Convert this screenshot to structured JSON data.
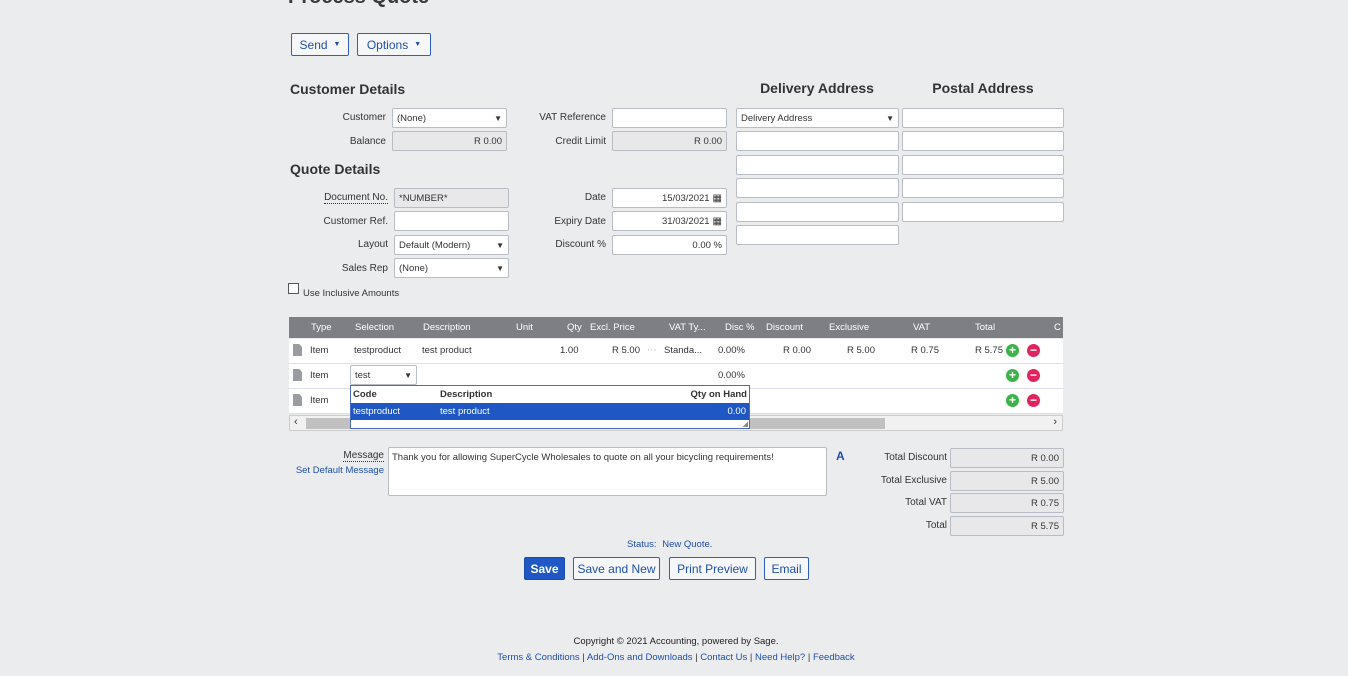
{
  "page": {
    "title": "Process Quote"
  },
  "toolbar": {
    "send_label": "Send",
    "options_label": "Options"
  },
  "customer_details": {
    "heading": "Customer Details",
    "customer_label": "Customer",
    "customer_value": "(None)",
    "balance_label": "Balance",
    "balance_value": "R 0.00",
    "vat_ref_label": "VAT Reference",
    "vat_ref_value": "",
    "credit_limit_label": "Credit Limit",
    "credit_limit_value": "R 0.00"
  },
  "quote_details": {
    "heading": "Quote Details",
    "doc_no_label": "Document No.",
    "doc_no_value": "*NUMBER*",
    "cust_ref_label": "Customer Ref.",
    "cust_ref_value": "",
    "layout_label": "Layout",
    "layout_value": "Default (Modern)",
    "sales_rep_label": "Sales Rep",
    "sales_rep_value": "(None)",
    "date_label": "Date",
    "date_value": "15/03/2021",
    "expiry_label": "Expiry Date",
    "expiry_value": "31/03/2021",
    "discount_label": "Discount %",
    "discount_value": "0.00 %",
    "inclusive_label": "Use Inclusive Amounts"
  },
  "delivery": {
    "heading": "Delivery Address",
    "select_value": "Delivery Address"
  },
  "postal": {
    "heading": "Postal Address"
  },
  "grid": {
    "headers": [
      "Type",
      "Selection",
      "Description",
      "Unit",
      "Qty",
      "Excl. Price",
      "VAT Ty...",
      "Disc %",
      "Discount",
      "Exclusive",
      "VAT",
      "Total",
      "C"
    ],
    "rows": [
      {
        "type": "Item",
        "selection": "testproduct",
        "description": "test product",
        "qty": "1.00",
        "price": "R 5.00",
        "vat_type": "Standa...",
        "disc": "0.00%",
        "discount": "R 0.00",
        "exclusive": "R 5.00",
        "vat": "R 0.75",
        "total": "R 5.75"
      },
      {
        "type": "Item",
        "selection": "test",
        "disc": "0.00%"
      },
      {
        "type": "Item"
      }
    ]
  },
  "lookup": {
    "headers": {
      "code": "Code",
      "description": "Description",
      "qty": "Qty on Hand"
    },
    "selected": {
      "code": "testproduct",
      "description": "test product",
      "qty": "0.00"
    }
  },
  "message": {
    "label": "Message",
    "set_default": "Set Default Message",
    "text": "Thank you for allowing SuperCycle Wholesales to quote on all your bicycling requirements!",
    "font_icon": "A"
  },
  "totals": {
    "total_discount_label": "Total Discount",
    "total_discount": "R 0.00",
    "total_exclusive_label": "Total Exclusive",
    "total_exclusive": "R 5.00",
    "total_vat_label": "Total VAT",
    "total_vat": "R 0.75",
    "total_label": "Total",
    "total": "R 5.75"
  },
  "status": {
    "label": "Status:",
    "value": "New Quote."
  },
  "actions": {
    "save": "Save",
    "save_new": "Save and New",
    "print_preview": "Print Preview",
    "email": "Email"
  },
  "footer": {
    "copyright": "Copyright © 2021 Accounting, powered by Sage.",
    "links": [
      "Terms & Conditions",
      "Add-Ons and Downloads",
      "Contact Us",
      "Need Help?",
      "Feedback"
    ],
    "separator": "|"
  }
}
